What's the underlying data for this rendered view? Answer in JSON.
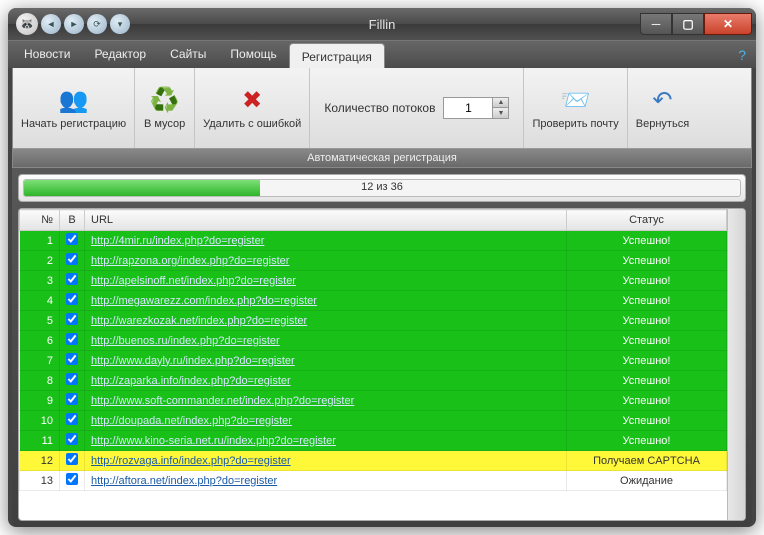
{
  "window": {
    "title": "Fillin"
  },
  "menu": {
    "items": [
      "Новости",
      "Редактор",
      "Сайты",
      "Помощь",
      "Регистрация"
    ],
    "active_index": 4
  },
  "ribbon": {
    "start_label": "Начать регистрацию",
    "trash_label": "В мусор",
    "delete_err_label": "Удалить с ошибкой",
    "threads_label": "Количество потоков",
    "threads_value": "1",
    "check_mail_label": "Проверить почту",
    "back_label": "Вернуться",
    "section_label": "Автоматическая регистрация"
  },
  "progress": {
    "text": "12 из 36",
    "percent": 33
  },
  "table": {
    "headers": {
      "num": "№",
      "b": "B",
      "url": "URL",
      "status": "Статус"
    },
    "rows": [
      {
        "n": 1,
        "url": "http://4mir.ru/index.php?do=register",
        "status": "Успешно!",
        "state": "success"
      },
      {
        "n": 2,
        "url": "http://rapzona.org/index.php?do=register",
        "status": "Успешно!",
        "state": "success"
      },
      {
        "n": 3,
        "url": "http://apelsinoff.net/index.php?do=register",
        "status": "Успешно!",
        "state": "success"
      },
      {
        "n": 4,
        "url": "http://megawarezz.com/index.php?do=register",
        "status": "Успешно!",
        "state": "success"
      },
      {
        "n": 5,
        "url": "http://warezkozak.net/index.php?do=register",
        "status": "Успешно!",
        "state": "success"
      },
      {
        "n": 6,
        "url": "http://buenos.ru/index.php?do=register",
        "status": "Успешно!",
        "state": "success"
      },
      {
        "n": 7,
        "url": "http://www.dayly.ru/index.php?do=register",
        "status": "Успешно!",
        "state": "success"
      },
      {
        "n": 8,
        "url": "http://zaparka.info/index.php?do=register",
        "status": "Успешно!",
        "state": "success"
      },
      {
        "n": 9,
        "url": "http://www.soft-commander.net/index.php?do=register",
        "status": "Успешно!",
        "state": "success"
      },
      {
        "n": 10,
        "url": "http://doupada.net/index.php?do=register",
        "status": "Успешно!",
        "state": "success"
      },
      {
        "n": 11,
        "url": "http://www.kino-seria.net.ru/index.php?do=register",
        "status": "Успешно!",
        "state": "success"
      },
      {
        "n": 12,
        "url": "http://rozvaga.info/index.php?do=register",
        "status": "Получаем CAPTCHA",
        "state": "captcha"
      },
      {
        "n": 13,
        "url": "http://aftora.net/index.php?do=register",
        "status": "Ожидание",
        "state": "waiting"
      }
    ]
  }
}
